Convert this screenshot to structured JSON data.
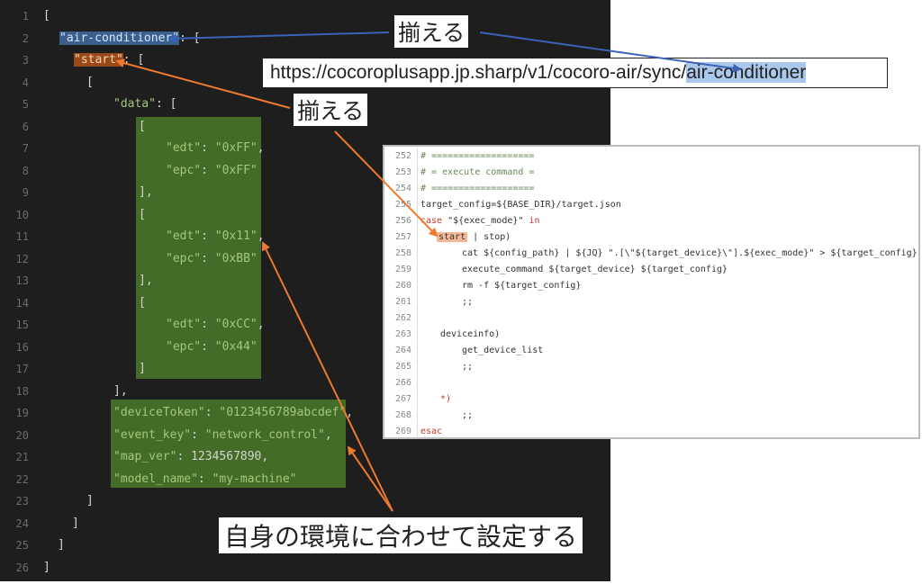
{
  "editor": {
    "lines": [
      {
        "n": "1"
      },
      {
        "n": "2"
      },
      {
        "n": "3"
      },
      {
        "n": "4"
      },
      {
        "n": "5"
      },
      {
        "n": "6"
      },
      {
        "n": "7"
      },
      {
        "n": "8"
      },
      {
        "n": "9"
      },
      {
        "n": "10"
      },
      {
        "n": "11"
      },
      {
        "n": "12"
      },
      {
        "n": "13"
      },
      {
        "n": "14"
      },
      {
        "n": "15"
      },
      {
        "n": "16"
      },
      {
        "n": "17"
      },
      {
        "n": "18"
      },
      {
        "n": "19"
      },
      {
        "n": "20"
      },
      {
        "n": "21"
      },
      {
        "n": "22"
      },
      {
        "n": "23"
      },
      {
        "n": "24"
      },
      {
        "n": "25"
      },
      {
        "n": "26"
      }
    ],
    "tokens": {
      "open_bracket": "[",
      "close_bracket": "]",
      "open_brace": "[",
      "close_brace": "]",
      "key_air": "\"air-conditioner\"",
      "key_start": "\"start\"",
      "key_data": "\"data\"",
      "edt_key": "\"edt\"",
      "epc_key": "\"epc\"",
      "edt1": "\"0xFF\"",
      "epc1": "\"0xFF\"",
      "edt2": "\"0x11\"",
      "epc2": "\"0xBB\"",
      "edt3": "\"0xCC\"",
      "epc3": "\"0x44\"",
      "deviceToken_key": "\"deviceToken\"",
      "deviceToken_val": "\"0123456789abcdef\"",
      "event_key_key": "\"event_key\"",
      "event_key_val": "\"network_control\"",
      "map_ver_key": "\"map_ver\"",
      "map_ver_val": "1234567890",
      "model_name_key": "\"model_name\"",
      "model_name_val": "\"my-machine\""
    }
  },
  "url": {
    "prefix": "https://cocoroplusapp.jp.sharp/v1/cocoro-air/sync/",
    "highlight": "air-conditioner"
  },
  "script": {
    "lines": [
      {
        "n": "252",
        "text": "# ==================="
      },
      {
        "n": "253",
        "text": "# = execute command ="
      },
      {
        "n": "254",
        "text": "# ==================="
      },
      {
        "n": "255",
        "text": "target_config=${BASE_DIR}/target.json"
      },
      {
        "n": "256",
        "kw": "case",
        "text": " \"${exec_mode}\" ",
        "kw2": "in"
      },
      {
        "n": "257",
        "start": "start",
        "text": " | stop)"
      },
      {
        "n": "258",
        "text": "cat ${config_path} | ${JQ} \".[\\\"${target_device}\\\"].${exec_mode}\" > ${target_config}"
      },
      {
        "n": "259",
        "text": "execute_command ${target_device} ${target_config}"
      },
      {
        "n": "260",
        "text": "rm -f ${target_config}"
      },
      {
        "n": "261",
        "text": ";;"
      },
      {
        "n": "262",
        "text": ""
      },
      {
        "n": "263",
        "text": "deviceinfo)"
      },
      {
        "n": "264",
        "text": "get_device_list"
      },
      {
        "n": "265",
        "text": ";;"
      },
      {
        "n": "266",
        "text": ""
      },
      {
        "n": "267",
        "text": "*)"
      },
      {
        "n": "268",
        "text": ";;"
      },
      {
        "n": "269",
        "text": "esac"
      }
    ]
  },
  "callouts": {
    "top": "揃える",
    "mid": "揃える",
    "bottom": "自身の環境に合わせて設定する"
  },
  "colors": {
    "editor_bg": "#1e1e1e",
    "string_green": "#a5c77c",
    "highlight_blue": "#3a5f8a",
    "highlight_orange": "#9a4a1a",
    "green_box": "#4a7a2a",
    "arrow_blue": "#3b63b8",
    "arrow_orange": "#ee7a2f"
  }
}
